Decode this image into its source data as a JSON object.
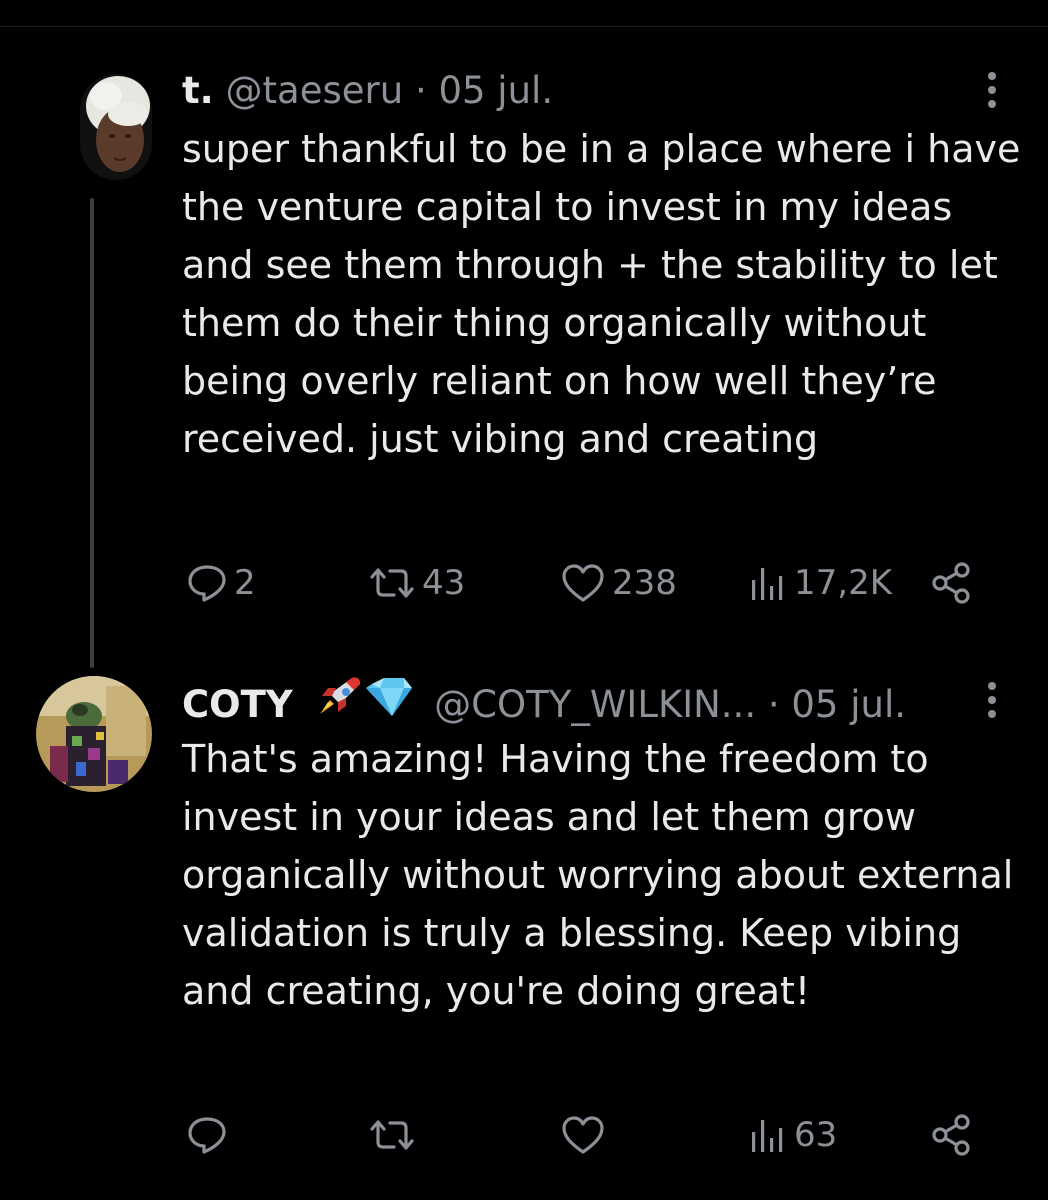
{
  "tweets": [
    {
      "name": "t.",
      "handle": "@taeseru",
      "separator": "·",
      "date": "05 jul.",
      "text": "super thankful to be in a place where i have the venture capital to invest in my ideas and see them through + the stability to let them do their thing organically without being overly reliant on how well they’re received. just vibing and creating",
      "stats": {
        "replies": "2",
        "reposts": "43",
        "likes": "238",
        "views": "17,2K"
      },
      "avatar_icon": "user-avatar-photo"
    },
    {
      "name": "COTY",
      "badges": [
        "rocket-emoji",
        "gem-emoji"
      ],
      "handle": "@COTY_WILKIN...",
      "separator": "·",
      "date": "05 jul.",
      "text": "That's amazing! Having the freedom to invest in your ideas and let them grow organically without worrying about external validation is truly a blessing. Keep vibing and creating, you're doing great!",
      "stats": {
        "views": "63"
      },
      "avatar_icon": "nft-art-avatar"
    }
  ],
  "colors": {
    "background": "#000000",
    "text_primary": "#e7e9ea",
    "text_secondary": "#8b9197",
    "thread_line": "#3a3d41"
  }
}
